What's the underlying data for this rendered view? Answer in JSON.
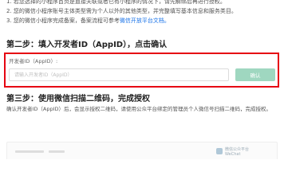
{
  "top_notes": {
    "line1": "1. 若您选择的小程序首页是直接关联或者已有小程序的情况下，请先解绑后再进行授权。",
    "line2": "2. 您的微信小程序账号主体类型需为个人以外的其他类型，并完整填写基本信息和服务类目。",
    "line3_text": "3. 您的微信小程序完成备案，备案流程可参考",
    "line3_link": "微信开放平台文档。"
  },
  "step2": {
    "heading": "第二步：填入开发者ID（AppID），点击确认",
    "field_label": "开发者ID（AppID）:",
    "input_value": "",
    "input_placeholder": "请输入开发者ID（AppID）",
    "confirm_label": "确认"
  },
  "step3": {
    "heading": "第三步：使用微信扫描二维码，完成授权",
    "description": "确认开发者ID（AppID）后，会显示授权二维码，请使用公众平台绑定的管理员个人微信号扫描二维码，完成授权。"
  },
  "preview": {
    "logo_text_line1": "微信公众平台",
    "logo_text_line2": "WeChat"
  },
  "colors": {
    "highlight_border": "#e60012",
    "confirm_button": "#9fd7c0",
    "link": "#1a73e8"
  }
}
